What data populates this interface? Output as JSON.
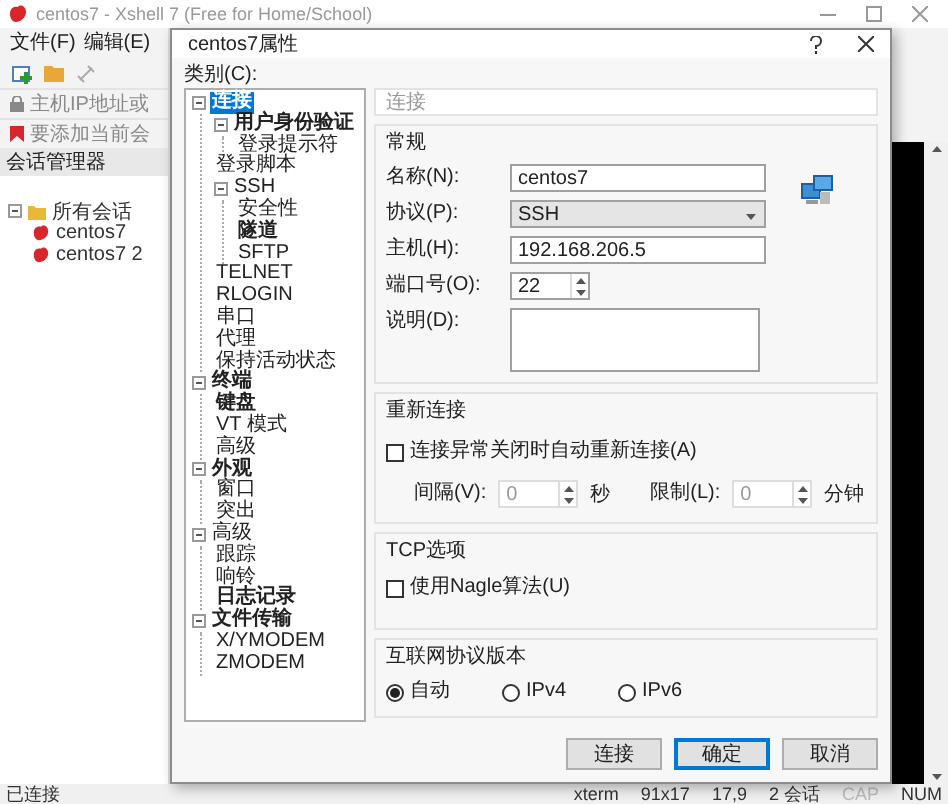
{
  "app": {
    "title": "centos7 - Xshell 7 (Free for Home/School)",
    "menu": [
      "文件(F)",
      "编辑(E)"
    ],
    "address_placeholder": "主机IP地址或",
    "hint": "要添加当前会",
    "session_manager": {
      "title": "会话管理器",
      "tree": [
        {
          "label": "所有会话",
          "kind": "folder",
          "expanded": true,
          "children": [
            {
              "label": "centos7",
              "kind": "session"
            },
            {
              "label": "centos7 2",
              "kind": "session"
            }
          ]
        }
      ]
    },
    "status_bar": {
      "left": "已连接",
      "items": [
        "xterm",
        "91x17",
        "17,9",
        "2 会话"
      ],
      "locks": [
        {
          "label": "CAP",
          "on": false
        },
        {
          "label": "NUM",
          "on": true
        }
      ]
    }
  },
  "dialog": {
    "title": "centos7属性",
    "category_label": "类别(C):",
    "tree": [
      {
        "label": "连接",
        "bold": true,
        "selected": true,
        "expanded": true,
        "children": [
          {
            "label": "用户身份验证",
            "bold": true,
            "selected": false,
            "expanded": true,
            "children": [
              {
                "label": "登录提示符",
                "bold": false,
                "selected": false
              }
            ]
          },
          {
            "label": "登录脚本",
            "bold": false,
            "selected": false
          },
          {
            "label": "SSH",
            "bold": false,
            "selected": false,
            "expanded": true,
            "children": [
              {
                "label": "安全性",
                "bold": false,
                "selected": false
              },
              {
                "label": "隧道",
                "bold": true,
                "selected": false
              },
              {
                "label": "SFTP",
                "bold": false,
                "selected": false
              }
            ]
          },
          {
            "label": "TELNET",
            "bold": false,
            "selected": false
          },
          {
            "label": "RLOGIN",
            "bold": false,
            "selected": false
          },
          {
            "label": "串口",
            "bold": false,
            "selected": false
          },
          {
            "label": "代理",
            "bold": false,
            "selected": false
          },
          {
            "label": "保持活动状态",
            "bold": false,
            "selected": false
          }
        ]
      },
      {
        "label": "终端",
        "bold": true,
        "selected": false,
        "expanded": true,
        "children": [
          {
            "label": "键盘",
            "bold": true,
            "selected": false
          },
          {
            "label": "VT 模式",
            "bold": false,
            "selected": false
          },
          {
            "label": "高级",
            "bold": false,
            "selected": false
          }
        ]
      },
      {
        "label": "外观",
        "bold": true,
        "selected": false,
        "expanded": true,
        "children": [
          {
            "label": "窗口",
            "bold": false,
            "selected": false
          },
          {
            "label": "突出",
            "bold": false,
            "selected": false
          }
        ]
      },
      {
        "label": "高级",
        "bold": false,
        "selected": false,
        "expanded": true,
        "children": [
          {
            "label": "跟踪",
            "bold": false,
            "selected": false
          },
          {
            "label": "响铃",
            "bold": false,
            "selected": false
          },
          {
            "label": "日志记录",
            "bold": true,
            "selected": false
          }
        ]
      },
      {
        "label": "文件传输",
        "bold": true,
        "selected": false,
        "expanded": true,
        "children": [
          {
            "label": "X/YMODEM",
            "bold": false,
            "selected": false
          },
          {
            "label": "ZMODEM",
            "bold": false,
            "selected": false
          }
        ]
      }
    ],
    "section_title": "连接",
    "groups": [
      {
        "kind": "general",
        "title": "常规",
        "fields": [
          {
            "kind": "text",
            "label": "名称(N):",
            "value": "centos7"
          },
          {
            "kind": "select",
            "label": "协议(P):",
            "value": "SSH"
          },
          {
            "kind": "text",
            "label": "主机(H):",
            "value": "192.168.206.5"
          },
          {
            "kind": "spin",
            "label": "端口号(O):",
            "value": "22"
          },
          {
            "kind": "textarea",
            "label": "说明(D):"
          }
        ]
      },
      {
        "kind": "reconnect",
        "title": "重新连接",
        "checkbox": {
          "label": "连接异常关闭时自动重新连接(A)",
          "checked": false
        },
        "spins": [
          {
            "label": "间隔(V):",
            "value": "0",
            "unit": "秒",
            "disabled": true
          },
          {
            "label": "限制(L):",
            "value": "0",
            "unit": "分钟",
            "disabled": true
          }
        ]
      },
      {
        "kind": "tcp",
        "title": "TCP选项",
        "checkbox": {
          "label": "使用Nagle算法(U)",
          "checked": false
        }
      },
      {
        "kind": "ip",
        "title": "互联网协议版本",
        "options": [
          {
            "label": "自动",
            "selected": true
          },
          {
            "label": "IPv4",
            "selected": false
          },
          {
            "label": "IPv6",
            "selected": false
          }
        ]
      }
    ],
    "buttons": [
      {
        "label": "连接",
        "default": false
      },
      {
        "label": "确定",
        "default": true
      },
      {
        "label": "取消",
        "default": false
      }
    ]
  }
}
